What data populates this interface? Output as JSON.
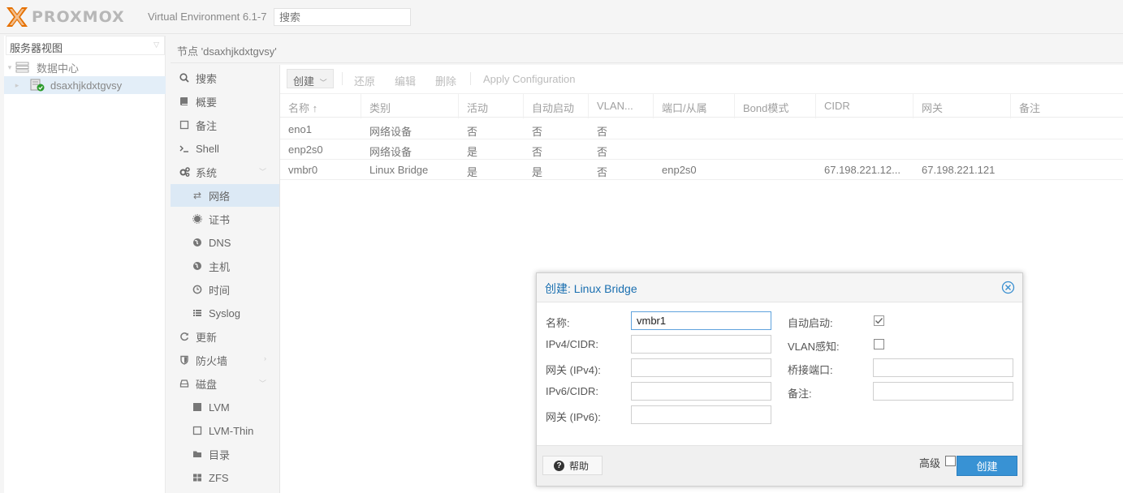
{
  "header": {
    "logo_text": "PROXMOX",
    "version": "Virtual Environment 6.1-7",
    "search_placeholder": "搜索"
  },
  "tree": {
    "view_label": "服务器视图",
    "items": [
      {
        "label": "数据中心"
      },
      {
        "label": "dsaxhjkdxtgvsy"
      }
    ]
  },
  "breadcrumb": "节点 'dsaxhjkdxtgvsy'",
  "nav": {
    "items": [
      {
        "label": "搜索",
        "icon": "search-icon"
      },
      {
        "label": "概要",
        "icon": "book-icon"
      },
      {
        "label": "备注",
        "icon": "note-icon"
      },
      {
        "label": "Shell",
        "icon": "terminal-icon"
      },
      {
        "label": "系统",
        "icon": "cogs-icon"
      },
      {
        "label": "网络",
        "icon": "exchange-icon"
      },
      {
        "label": "证书",
        "icon": "certificate-icon"
      },
      {
        "label": "DNS",
        "icon": "globe-icon"
      },
      {
        "label": "主机",
        "icon": "globe-icon"
      },
      {
        "label": "时间",
        "icon": "clock-icon"
      },
      {
        "label": "Syslog",
        "icon": "list-icon"
      },
      {
        "label": "更新",
        "icon": "refresh-icon"
      },
      {
        "label": "防火墙",
        "icon": "shield-icon"
      },
      {
        "label": "磁盘",
        "icon": "hdd-icon"
      },
      {
        "label": "LVM",
        "icon": "square-icon"
      },
      {
        "label": "LVM-Thin",
        "icon": "square-outline-icon"
      },
      {
        "label": "目录",
        "icon": "folder-icon"
      },
      {
        "label": "ZFS",
        "icon": "th-large-icon"
      }
    ]
  },
  "toolbar": {
    "create": "创建",
    "revert": "还原",
    "edit": "编辑",
    "remove": "删除",
    "apply": "Apply Configuration"
  },
  "grid": {
    "columns": [
      "名称 ↑",
      "类别",
      "活动",
      "自动启动",
      "VLAN...",
      "端口/从属",
      "Bond模式",
      "CIDR",
      "网关",
      "备注"
    ],
    "rows": [
      [
        "eno1",
        "网络设备",
        "否",
        "否",
        "否",
        "",
        "",
        "",
        "",
        ""
      ],
      [
        "enp2s0",
        "网络设备",
        "是",
        "否",
        "否",
        "",
        "",
        "",
        "",
        ""
      ],
      [
        "vmbr0",
        "Linux Bridge",
        "是",
        "是",
        "否",
        "enp2s0",
        "",
        "67.198.221.12...",
        "67.198.221.121",
        ""
      ]
    ]
  },
  "dialog": {
    "title": "创建: Linux Bridge",
    "fields": {
      "name_label": "名称:",
      "name_value": "vmbr1",
      "ipv4_label": "IPv4/CIDR:",
      "gw4_label": "网关 (IPv4):",
      "ipv6_label": "IPv6/CIDR:",
      "gw6_label": "网关 (IPv6):",
      "autostart_label": "自动启动:",
      "autostart_checked": true,
      "vlan_label": "VLAN感知:",
      "vlan_checked": false,
      "ports_label": "桥接端口:",
      "comment_label": "备注:"
    },
    "help": "帮助",
    "advanced": "高级",
    "create": "创建"
  }
}
